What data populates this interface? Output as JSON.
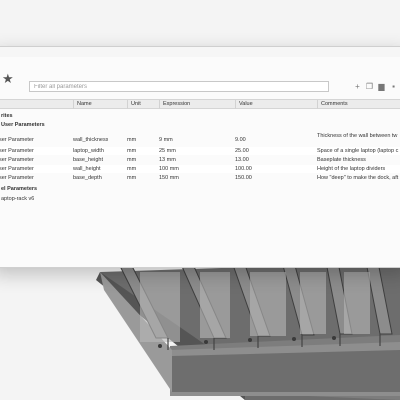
{
  "toolbar": {
    "filter_placeholder": "Filter all parameters",
    "star_icon": "star-icon",
    "add_icon": "plus-icon",
    "copy_icon": "copy-icon",
    "delete_icon": "trash-icon",
    "more_icon": "more-icon"
  },
  "table": {
    "headers": [
      "",
      "Name",
      "Unit",
      "Expression",
      "Value",
      "Comments"
    ],
    "groups": {
      "favorites": "rites",
      "user_params": "User Parameters",
      "model_params": "el Parameters",
      "model_item": "aptop-rack v6"
    },
    "rows": [
      {
        "type": "User Parameter",
        "name": "wall_thickness",
        "unit": "mm",
        "expression": "9 mm",
        "value": "9.00",
        "comment": "Thickness of the wall between tw"
      },
      {
        "type": "User Parameter",
        "name": "laptop_width",
        "unit": "mm",
        "expression": "25 mm",
        "value": "25.00",
        "comment": "Space of a single laptop (laptop c"
      },
      {
        "type": "User Parameter",
        "name": "base_height",
        "unit": "mm",
        "expression": "13 mm",
        "value": "13.00",
        "comment": "Baseplate thickness"
      },
      {
        "type": "User Parameter",
        "name": "wall_height",
        "unit": "mm",
        "expression": "100 mm",
        "value": "100.00",
        "comment": "Height of the laptop dividers"
      },
      {
        "type": "User Parameter",
        "name": "base_depth",
        "unit": "mm",
        "expression": "150 mm",
        "value": "150.00",
        "comment": "How \"deep\" to make the dock, aft"
      }
    ]
  },
  "colors": {
    "model_face": "#8a8a8a",
    "model_dark": "#4a4a4a",
    "background": "#f3f3f3"
  }
}
